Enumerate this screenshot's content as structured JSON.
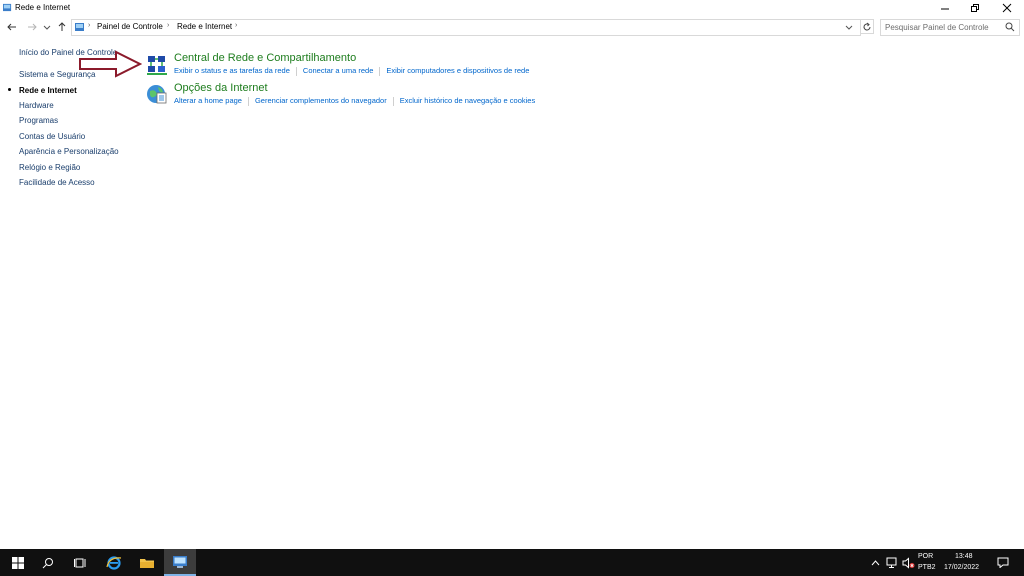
{
  "window": {
    "title": "Rede e Internet"
  },
  "address": {
    "crumbs": [
      "Painel de Controle",
      "Rede e Internet"
    ],
    "search_placeholder": "Pesquisar Painel de Controle"
  },
  "sidebar": {
    "home": "Início do Painel de Controle",
    "items": [
      {
        "label": "Sistema e Segurança"
      },
      {
        "label": "Rede e Internet"
      },
      {
        "label": "Hardware"
      },
      {
        "label": "Programas"
      },
      {
        "label": "Contas de Usuário"
      },
      {
        "label": "Aparência e Personalização"
      },
      {
        "label": "Relógio e Região"
      },
      {
        "label": "Facilidade de Acesso"
      }
    ],
    "current_index": 1
  },
  "sections": [
    {
      "title": "Central de Rede e Compartilhamento",
      "icon": "network-center-icon",
      "links": [
        "Exibir o status e as tarefas da rede",
        "Conectar a uma rede",
        "Exibir computadores e dispositivos de rede"
      ]
    },
    {
      "title": "Opções da Internet",
      "icon": "internet-options-icon",
      "links": [
        "Alterar a home page",
        "Gerenciar complementos do navegador",
        "Excluir histórico de navegação e cookies"
      ]
    }
  ],
  "taskbar": {
    "language_top": "POR",
    "language_bottom": "PTB2",
    "time": "13:48",
    "date": "17/02/2022"
  },
  "colors": {
    "section_heading": "#1e7d1e",
    "link": "#0066cc",
    "annotation_arrow": "#8b1a2b",
    "taskbar": "#101010"
  }
}
